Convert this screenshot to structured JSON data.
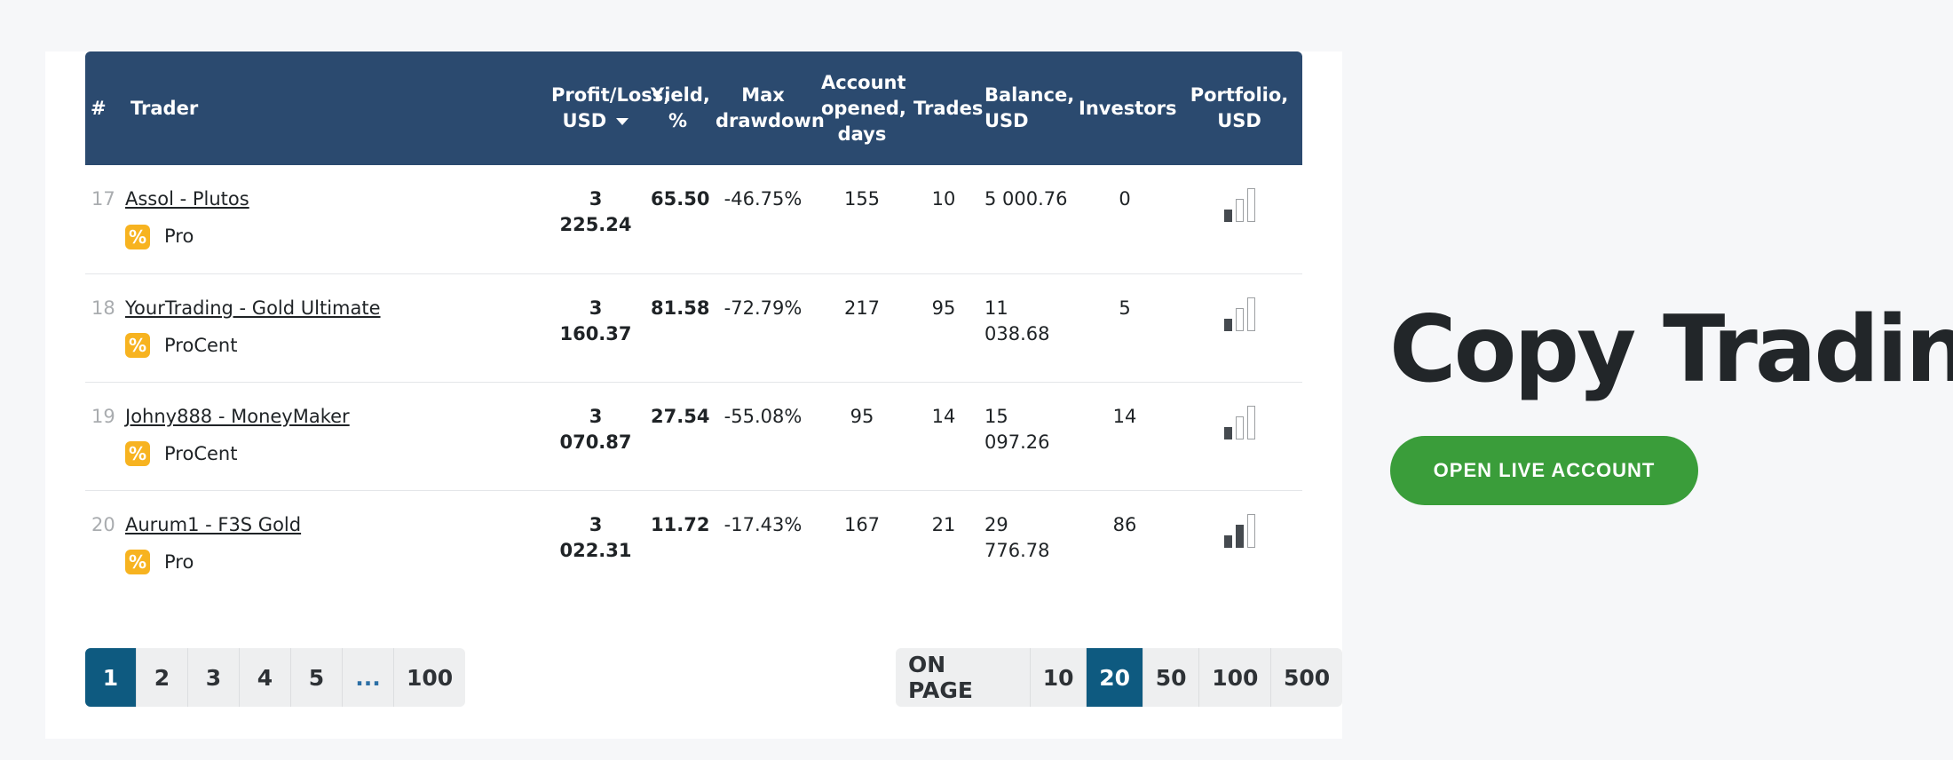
{
  "table": {
    "headers": {
      "num": "#",
      "trader": "Trader",
      "profit": "Profit/Loss, USD",
      "yield": "Yield, %",
      "drawdown": "Max drawdown",
      "opened": "Account opened, days",
      "trades": "Trades",
      "balance": "Balance, USD",
      "investors": "Investors",
      "portfolio": "Portfolio, USD"
    },
    "rows": [
      {
        "num": "17",
        "trader": "Assol - Plutos",
        "tag": "Pro",
        "profit": "3 225.24",
        "yield": "65.50",
        "drawdown": "-46.75%",
        "opened": "155",
        "trades": "10",
        "balance": "5 000.76",
        "investors": "0",
        "portfolio_level": 1
      },
      {
        "num": "18",
        "trader": "YourTrading - Gold Ultimate",
        "tag": "ProCent",
        "profit": "3 160.37",
        "yield": "81.58",
        "drawdown": "-72.79%",
        "opened": "217",
        "trades": "95",
        "balance": "11 038.68",
        "investors": "5",
        "portfolio_level": 1
      },
      {
        "num": "19",
        "trader": "Johny888 - MoneyMaker",
        "tag": "ProCent",
        "profit": "3 070.87",
        "yield": "27.54",
        "drawdown": "-55.08%",
        "opened": "95",
        "trades": "14",
        "balance": "15 097.26",
        "investors": "14",
        "portfolio_level": 1
      },
      {
        "num": "20",
        "trader": "Aurum1 - F3S Gold",
        "tag": "Pro",
        "profit": "3 022.31",
        "yield": "11.72",
        "drawdown": "-17.43%",
        "opened": "167",
        "trades": "21",
        "balance": "29 776.78",
        "investors": "86",
        "portfolio_level": 2
      }
    ]
  },
  "pagination": {
    "pages": [
      "1",
      "2",
      "3",
      "4",
      "5",
      "...",
      "100"
    ],
    "active": "1"
  },
  "per_page": {
    "label": "ON PAGE",
    "options": [
      "10",
      "20",
      "50",
      "100",
      "500"
    ],
    "active": "20"
  },
  "hero": {
    "title": "Copy Trading",
    "cta": "OPEN LIVE ACCOUNT"
  },
  "colors": {
    "header_bg": "#2b4a6f",
    "accent_blue": "#0e5a80",
    "cta_green": "#3a9d3a",
    "tag_orange": "#f7b320"
  },
  "icons": {
    "tag": "percent-icon",
    "portfolio": "signal-bars-icon",
    "sort": "caret-down-icon"
  }
}
